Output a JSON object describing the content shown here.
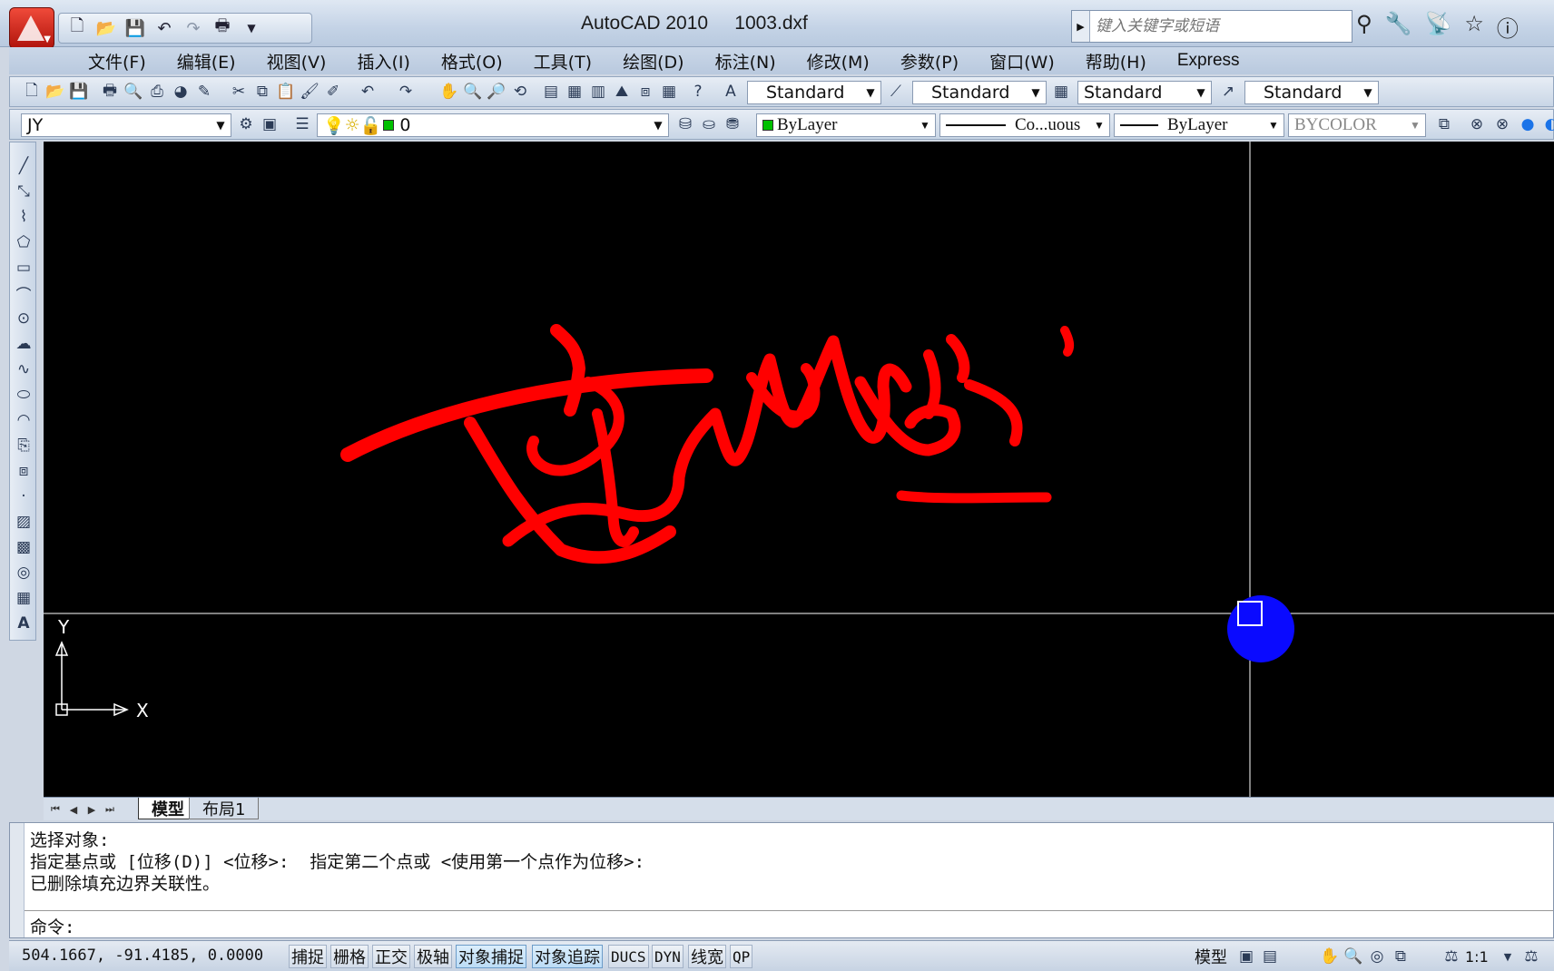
{
  "window": {
    "title": "AutoCAD 2010     1003.dxf",
    "search_placeholder": "键入关键字或短语"
  },
  "quick_access": [
    "new-icon",
    "open-icon",
    "save-icon",
    "undo-icon",
    "redo-icon",
    "plot-icon"
  ],
  "menu": [
    "文件(F)",
    "编辑(E)",
    "视图(V)",
    "插入(I)",
    "格式(O)",
    "工具(T)",
    "绘图(D)",
    "标注(N)",
    "修改(M)",
    "参数(P)",
    "窗口(W)",
    "帮助(H)",
    "Express"
  ],
  "styles_toolbar": {
    "text_style": "Standard",
    "dim_style": "Standard",
    "table_style": "Standard",
    "multileader_style": "Standard"
  },
  "layers_toolbar": {
    "workspace": "JY",
    "layer": "0",
    "color": "ByLayer",
    "linetype": "Co...uous",
    "lineweight": "ByLayer",
    "plot_style": "BYCOLOR"
  },
  "drawing": {
    "background": "#000000",
    "stroke_color": "#ff0000",
    "grip_color": "#0a0aff",
    "ucs_x_label": "X",
    "ucs_y_label": "Y"
  },
  "layout_tabs": [
    "模型",
    "布局1"
  ],
  "command_window": {
    "history": [
      "选择对象:",
      "指定基点或 [位移(D)] <位移>:  指定第二个点或 <使用第一个点作为位移>:",
      "已删除填充边界关联性。"
    ],
    "prompt": "命令:"
  },
  "status_bar": {
    "coordinates": "504.1667, -91.4185, 0.0000",
    "toggles": [
      {
        "label": "捕捉",
        "on": false
      },
      {
        "label": "栅格",
        "on": false
      },
      {
        "label": "正交",
        "on": false
      },
      {
        "label": "极轴",
        "on": false
      },
      {
        "label": "对象捕捉",
        "on": true
      },
      {
        "label": "对象追踪",
        "on": true
      },
      {
        "label": "DUCS",
        "on": false
      },
      {
        "label": "DYN",
        "on": false
      },
      {
        "label": "线宽",
        "on": false
      },
      {
        "label": "QP",
        "on": false
      }
    ],
    "model_label": "模型",
    "annotation_scale": "1:1"
  }
}
